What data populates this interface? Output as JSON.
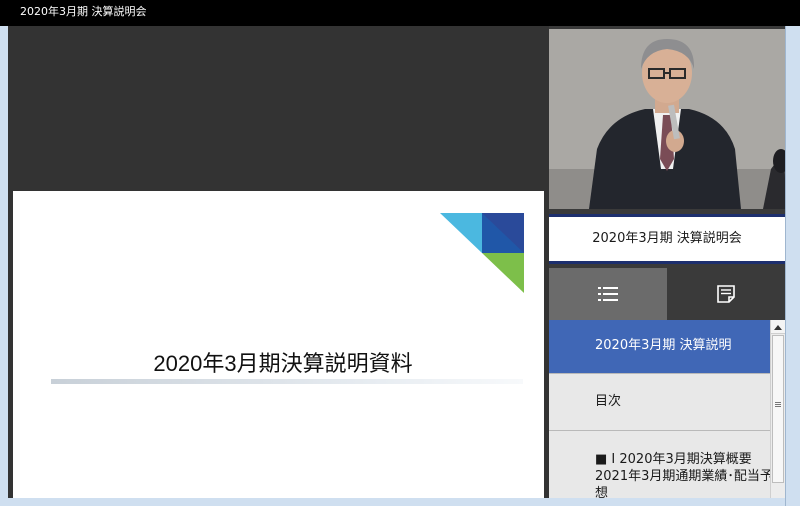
{
  "window": {
    "title": "2020年3月期 決算説明会"
  },
  "slide": {
    "title": "2020年3月期決算説明資料"
  },
  "video": {
    "description_icon": "presenter-video"
  },
  "banner": {
    "text": "2020年3月期 決算説明会"
  },
  "tabs": {
    "list_icon": "list-icon",
    "notes_icon": "notes-icon"
  },
  "chapters": [
    {
      "label": "2020年3月期 決算説明"
    },
    {
      "label": "目次"
    },
    {
      "line1": "■ I 2020年3月期決算概要",
      "line2": "2021年3月期通期業績･配当予",
      "line3": "想"
    }
  ],
  "colors": {
    "accent": "#4067b6",
    "banner_border": "#1d2f6e"
  }
}
